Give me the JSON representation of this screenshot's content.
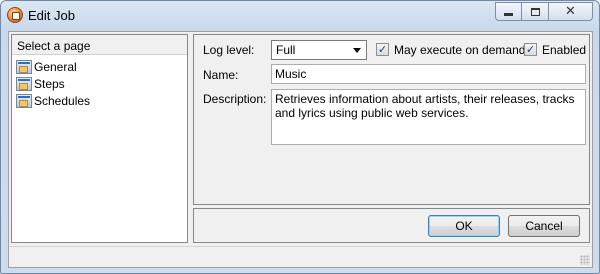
{
  "window": {
    "title": "Edit Job"
  },
  "sidebar": {
    "header": "Select a page",
    "items": [
      {
        "label": "General",
        "icon": "properties-icon"
      },
      {
        "label": "Steps",
        "icon": "properties-icon"
      },
      {
        "label": "Schedules",
        "icon": "properties-icon"
      }
    ]
  },
  "form": {
    "log_level_label": "Log level:",
    "log_level_value": "Full",
    "execute_on_demand_label": "May execute on demand",
    "execute_on_demand_checked": "✓",
    "enabled_label": "Enabled",
    "enabled_checked": "✓",
    "name_label": "Name:",
    "name_value": "Music",
    "description_label": "Description:",
    "description_value": "Retrieves information about artists, their releases, tracks and lyrics using public web services."
  },
  "buttons": {
    "ok": "OK",
    "cancel": "Cancel"
  }
}
